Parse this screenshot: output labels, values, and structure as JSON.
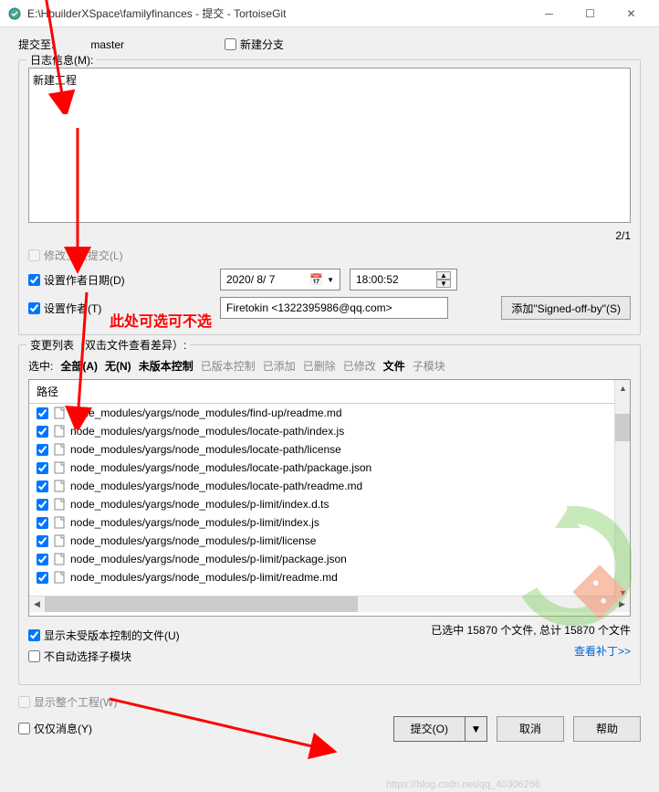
{
  "titlebar": {
    "title": "E:\\HbuilderXSpace\\familyfinances - 提交 - TortoiseGit"
  },
  "commit_to": {
    "label": "提交至:",
    "branch": "master",
    "new_branch_label": "新建分支"
  },
  "log": {
    "fieldset_title": "日志信息(M):",
    "message": "新建工程",
    "counter": "2/1"
  },
  "options": {
    "amend_label": "修改上次提交(L)",
    "set_date_label": "设置作者日期(D)",
    "date_value": "2020/ 8/ 7",
    "time_value": "18:00:52",
    "set_author_label": "设置作者(T)",
    "author_value": "Firetokin <1322395986@qq.com>",
    "signed_off_label": "添加\"Signed-off-by\"(S)"
  },
  "annotation_text": "此处可选可不选",
  "changes": {
    "fieldset_title": "变更列表（双击文件查看差异）:",
    "select_label": "选中:",
    "filters": {
      "all": "全部(A)",
      "none": "无(N)",
      "unversioned": "未版本控制",
      "versioned": "已版本控制",
      "added": "已添加",
      "deleted": "已删除",
      "modified": "已修改",
      "files": "文件",
      "submodules": "子模块"
    },
    "columns": {
      "path": "路径"
    },
    "files": [
      "node_modules/yargs/node_modules/find-up/readme.md",
      "node_modules/yargs/node_modules/locate-path/index.js",
      "node_modules/yargs/node_modules/locate-path/license",
      "node_modules/yargs/node_modules/locate-path/package.json",
      "node_modules/yargs/node_modules/locate-path/readme.md",
      "node_modules/yargs/node_modules/p-limit/index.d.ts",
      "node_modules/yargs/node_modules/p-limit/index.js",
      "node_modules/yargs/node_modules/p-limit/license",
      "node_modules/yargs/node_modules/p-limit/package.json",
      "node_modules/yargs/node_modules/p-limit/readme.md"
    ],
    "status": "已选中 15870 个文件, 总计 15870 个文件",
    "show_unversioned_label": "显示未受版本控制的文件(U)",
    "no_auto_submodule_label": "不自动选择子模块",
    "view_patch_label": "查看补丁>>"
  },
  "footer": {
    "show_whole_project_label": "显示整个工程(W)",
    "message_only_label": "仅仅消息(Y)",
    "commit_label": "提交(O)",
    "cancel_label": "取消",
    "help_label": "帮助"
  },
  "watermark_text": "https://blog.csdn.net/qq_40306266"
}
